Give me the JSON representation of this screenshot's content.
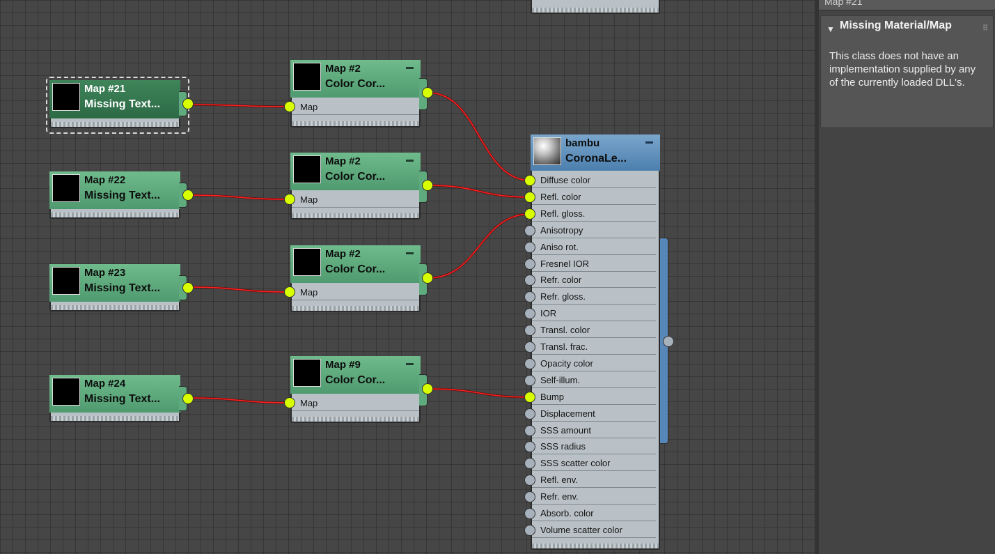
{
  "panel": {
    "topbar_title": "Map #21",
    "rollout_title": "Missing Material/Map",
    "message": "This class does not have an implementation supplied by any of the currently loaded DLL's."
  },
  "source_nodes": [
    {
      "name": "Map #21",
      "type": "Missing Text..."
    },
    {
      "name": "Map #22",
      "type": "Missing Text..."
    },
    {
      "name": "Map #23",
      "type": "Missing Text..."
    },
    {
      "name": "Map #24",
      "type": "Missing Text..."
    }
  ],
  "cc_nodes": [
    {
      "name": "Map #2",
      "type": "Color Cor...",
      "input": "Map"
    },
    {
      "name": "Map #2",
      "type": "Color Cor...",
      "input": "Map"
    },
    {
      "name": "Map #2",
      "type": "Color Cor...",
      "input": "Map"
    },
    {
      "name": "Map #9",
      "type": "Color Cor...",
      "input": "Map"
    }
  ],
  "material": {
    "name": "bambu",
    "type": "CoronaLe...",
    "slots": [
      "Diffuse color",
      "Refl. color",
      "Refl. gloss.",
      "Anisotropy",
      "Aniso rot.",
      "Fresnel IOR",
      "Refr. color",
      "Refr. gloss.",
      "IOR",
      "Transl. color",
      "Transl. frac.",
      "Opacity color",
      "Self-illum.",
      "Bump",
      "Displacement",
      "SSS amount",
      "SSS radius",
      "SSS scatter color",
      "Refl. env.",
      "Refr. env.",
      "Absorb. color",
      "Volume scatter color"
    ],
    "connected_slots": [
      0,
      1,
      2,
      13
    ]
  },
  "colors": {
    "wire": "#ff2020",
    "socket_on": "#d8ff00",
    "socket_off": "#a7b1bc",
    "node_green": "#5fab7d",
    "node_selected": "#2f6f48",
    "material_header": "#5d8fbf"
  }
}
